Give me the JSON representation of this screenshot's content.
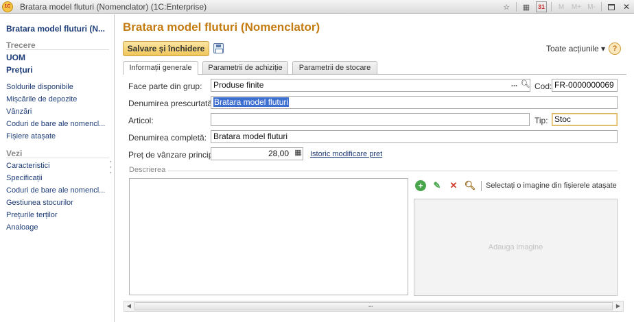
{
  "window": {
    "logo": "1C",
    "title": "Bratara model fluturi (Nomenclator)  (1C:Enterprise)",
    "icons": [
      "star-icon",
      "calculator-icon",
      "calendar-icon",
      "m-icon",
      "mplus-icon",
      "mminus-icon",
      "restore-icon",
      "close-icon"
    ],
    "calendar_day": "31",
    "m_label": "M",
    "mplus_label": "M+",
    "mminus_label": "M-",
    "close_glyph": "✕"
  },
  "nav": {
    "title": "Bratara model fluturi (N...",
    "trecere_label": "Trecere",
    "uom": "UOM",
    "preturi": "Prețuri",
    "links_a": [
      "Soldurile disponibile",
      "Mișcările de depozite",
      "Vânzări",
      "Coduri de bare ale nomencl...",
      "Fișiere atașate"
    ],
    "vezi_label": "Vezi",
    "links_b": [
      "Caracteristici",
      "Specificații",
      "Coduri de bare ale nomencl...",
      "Gestiunea stocurilor",
      "Prețurile terților",
      "Analoage"
    ]
  },
  "main": {
    "title": "Bratara model fluturi (Nomenclator)",
    "save_button": "Salvare și închidere",
    "actions_label": "Toate acțiunile ▾",
    "help_label": "?",
    "tabs": [
      "Informații generale",
      "Parametrii de achiziție",
      "Parametrii de stocare"
    ],
    "form": {
      "group_label": "Face parte din grup:",
      "group_value": "Produse finite",
      "group_dots": "...",
      "cod_label": "Cod:",
      "cod_value": "FR-0000000069",
      "short_name_label": "Denumirea prescurtată :",
      "short_name_value": "Bratara model fluturi",
      "articol_label": "Articol:",
      "articol_value": "",
      "tip_label": "Tip:",
      "tip_value": "Stoc",
      "full_name_label": "Denumirea completă:",
      "full_name_value": "Bratara model fluturi",
      "price_label": "Preț de vânzare principal:",
      "price_value": "28,00",
      "price_history_link": "Istoric modificare pret",
      "description_label": "Descrierea",
      "description_value": "",
      "image_select_label": "Selectați o imagine din fișierele atașate",
      "image_placeholder": "Adauga imagine"
    }
  }
}
